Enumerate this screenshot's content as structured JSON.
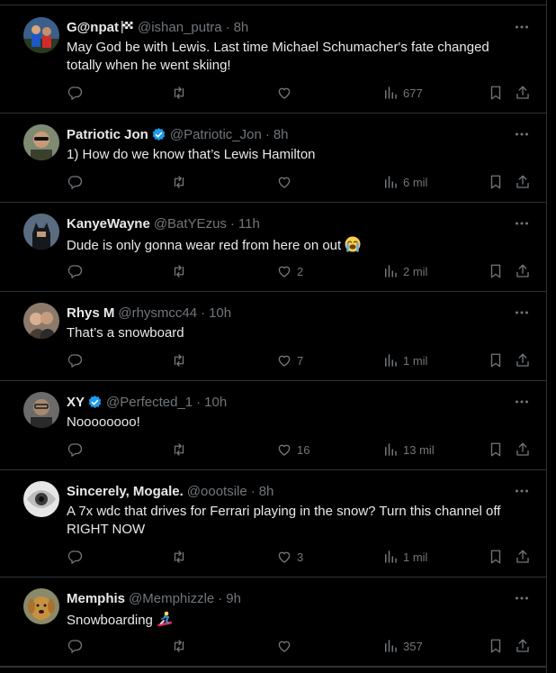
{
  "tweets": [
    {
      "display_name": "G@npat",
      "verified": false,
      "name_emoji": "checkered-flag",
      "handle": "@ishan_putra",
      "separator": "·",
      "time": "8h",
      "text": "May God be with Lewis. Last time Michael Schumacher's fate changed totally when he went skiing!",
      "likes": "",
      "views": "677",
      "avatar": "avatar-people-red-blue"
    },
    {
      "display_name": "Patriotic Jon",
      "verified": true,
      "handle": "@Patriotic_Jon",
      "separator": "·",
      "time": "8h",
      "text": "1) How do we know that’s Lewis Hamilton",
      "likes": "",
      "views": "6 mil",
      "avatar": "avatar-man-sunglasses"
    },
    {
      "display_name": "KanyeWayne",
      "verified": false,
      "handle": "@BatYEzus",
      "separator": "·",
      "time": "11h",
      "text": "Dude is only gonna wear red from here on out",
      "text_emoji": "loudly-crying-face",
      "likes": "2",
      "views": "2 mil",
      "avatar": "avatar-batman"
    },
    {
      "display_name": "Rhys M",
      "verified": false,
      "handle": "@rhysmcc44",
      "separator": "·",
      "time": "10h",
      "text": "That’s a snowboard",
      "likes": "7",
      "views": "1 mil",
      "avatar": "avatar-couple"
    },
    {
      "display_name": "XY",
      "verified": true,
      "handle": "@Perfected_1",
      "separator": "·",
      "time": "10h",
      "text": "Noooooooo!",
      "likes": "16",
      "views": "13 mil",
      "avatar": "avatar-man-glasses"
    },
    {
      "display_name": "Sincerely, Mogale.",
      "verified": false,
      "handle": "@oootsile",
      "separator": "·",
      "time": "8h",
      "text": "A 7x wdc that drives for Ferrari playing in the snow? Turn this channel off RIGHT NOW",
      "likes": "3",
      "views": "1 mil",
      "avatar": "avatar-eye"
    },
    {
      "display_name": "Memphis",
      "verified": false,
      "handle": "@Memphizzle",
      "separator": "·",
      "time": "9h",
      "text": "Snowboarding",
      "text_emoji": "snowboarder",
      "likes": "",
      "views": "357",
      "avatar": "avatar-dog"
    }
  ],
  "icons": {
    "more": "more-icon",
    "reply": "reply-icon",
    "retweet": "retweet-icon",
    "like": "like-icon",
    "views": "views-icon",
    "bookmark": "bookmark-icon",
    "share": "share-icon",
    "verified": "verified-badge-icon"
  },
  "colors": {
    "background": "#000000",
    "text": "#e7e9ea",
    "secondary_text": "#71767b",
    "border": "#2f3336",
    "verified_blue": "#1d9bf0"
  }
}
